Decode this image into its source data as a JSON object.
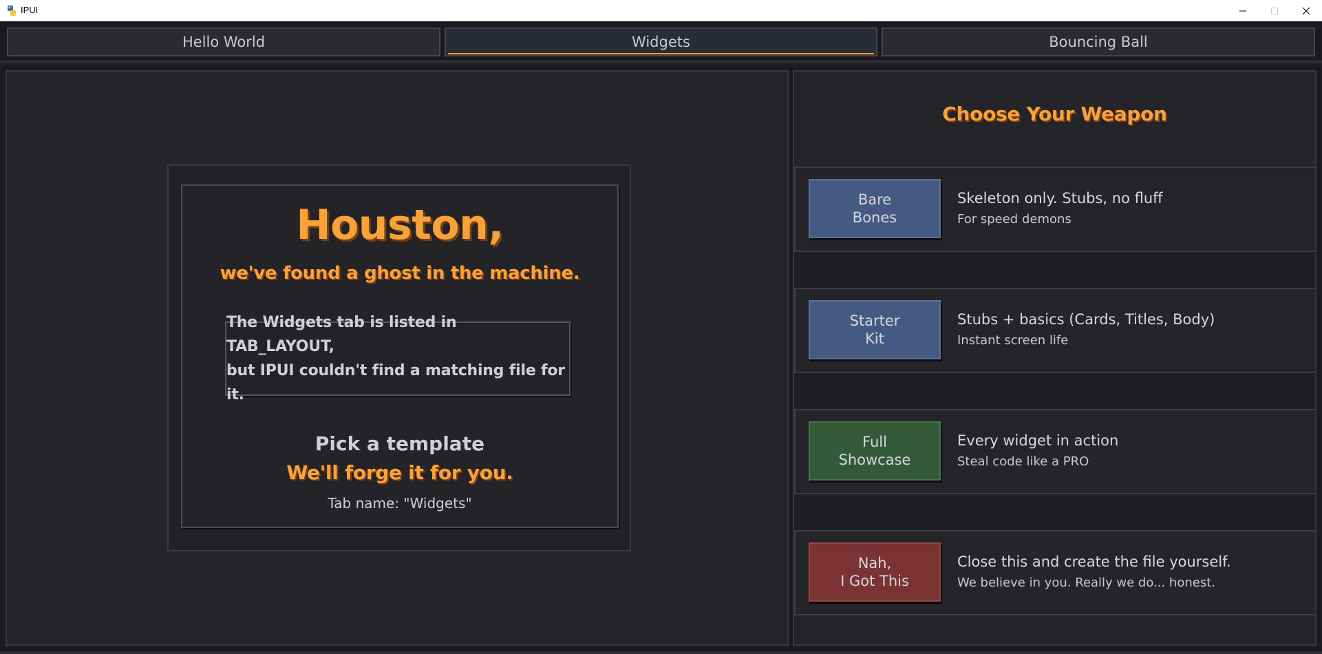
{
  "window": {
    "title": "IPUI",
    "icon": "python-icon"
  },
  "tabs": [
    {
      "label": "Hello World",
      "active": false
    },
    {
      "label": "Widgets",
      "active": true
    },
    {
      "label": "Bouncing Ball",
      "active": false
    }
  ],
  "ghost": {
    "heading": "Houston,",
    "subheading": "we've found a ghost in the machine.",
    "message_line1": "The Widgets tab is listed in TAB_LAYOUT,",
    "message_line2": "but IPUI couldn't find a matching file for it.",
    "pick_label": "Pick a template",
    "forge_label": "We'll forge it for you.",
    "tab_name_label": "Tab name: \"Widgets\""
  },
  "weapon": {
    "title": "Choose Your Weapon",
    "options": [
      {
        "button_line1": "Bare",
        "button_line2": "Bones",
        "main": "Skeleton only. Stubs, no fluff",
        "sub": "For speed demons",
        "color": "#455a82"
      },
      {
        "button_line1": "Starter",
        "button_line2": "Kit",
        "main": "Stubs + basics (Cards, Titles, Body)",
        "sub": "Instant screen life",
        "color": "#455a82"
      },
      {
        "button_line1": "Full",
        "button_line2": "Showcase",
        "main": "Every widget in action",
        "sub": "Steal code like a PRO",
        "color": "#335a37"
      },
      {
        "button_line1": "Nah,",
        "button_line2": "I Got This",
        "main": "Close this and create the file yourself.",
        "sub": "We believe in you. Really we do... honest.",
        "color": "#7a3232"
      }
    ]
  },
  "colors": {
    "accent": "#f8a23a",
    "background": "#242429",
    "tab_underline": "#f0a030"
  }
}
